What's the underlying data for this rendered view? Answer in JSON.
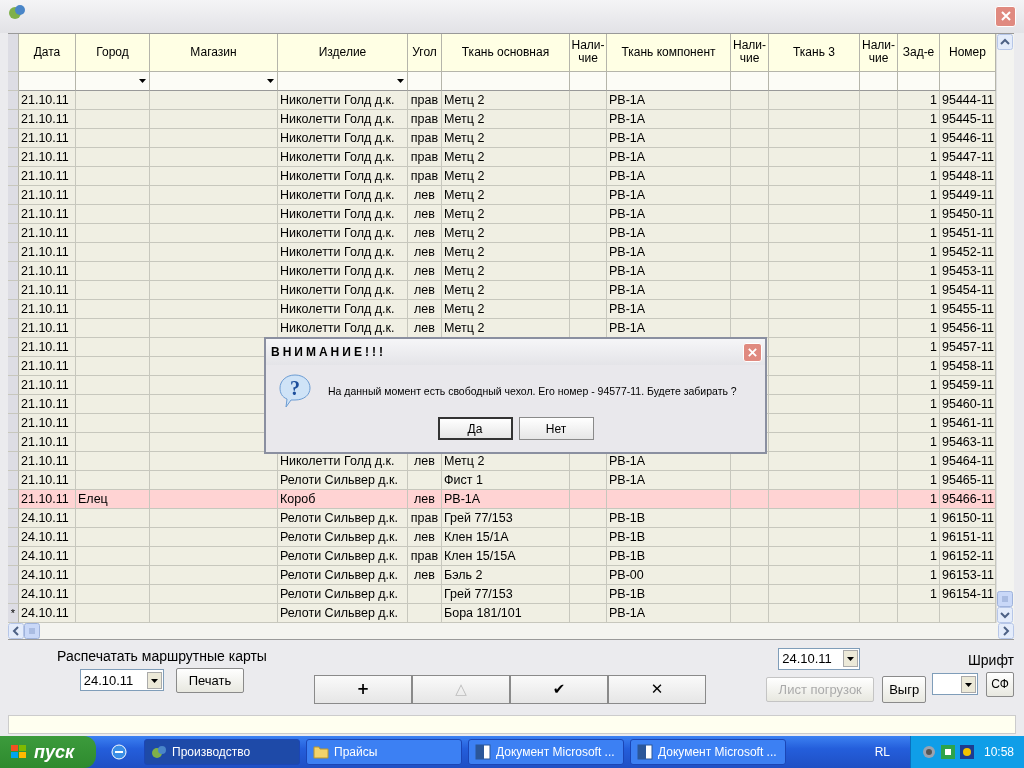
{
  "table": {
    "columns": [
      {
        "label": "Дата",
        "filter": false
      },
      {
        "label": "Город",
        "filter": true
      },
      {
        "label": "Магазин",
        "filter": true
      },
      {
        "label": "Изделие",
        "filter": true
      },
      {
        "label": "Угол",
        "filter": false
      },
      {
        "label": "Ткань основная",
        "filter": false
      },
      {
        "label": "Нали-\nчие",
        "filter": false
      },
      {
        "label": "Ткань компонент",
        "filter": false
      },
      {
        "label": "Нали-\nчие",
        "filter": false
      },
      {
        "label": "Ткань 3",
        "filter": false
      },
      {
        "label": "Нали-\nчие",
        "filter": false
      },
      {
        "label": "Зад-е",
        "filter": false
      },
      {
        "label": "Номер",
        "filter": false
      }
    ],
    "rows": [
      {
        "selected": false,
        "cells": [
          "21.10.11",
          null,
          null,
          "Николетти Голд д.к.",
          "прав",
          "Метц 2",
          null,
          "РВ-1А",
          null,
          null,
          null,
          "1",
          "95444-11"
        ]
      },
      {
        "selected": false,
        "cells": [
          "21.10.11",
          null,
          null,
          "Николетти Голд д.к.",
          "прав",
          "Метц 2",
          null,
          "РВ-1А",
          null,
          null,
          null,
          "1",
          "95445-11"
        ]
      },
      {
        "selected": false,
        "cells": [
          "21.10.11",
          null,
          null,
          "Николетти Голд д.к.",
          "прав",
          "Метц 2",
          null,
          "РВ-1А",
          null,
          null,
          null,
          "1",
          "95446-11"
        ]
      },
      {
        "selected": false,
        "cells": [
          "21.10.11",
          null,
          null,
          "Николетти Голд д.к.",
          "прав",
          "Метц 2",
          null,
          "РВ-1А",
          null,
          null,
          null,
          "1",
          "95447-11"
        ]
      },
      {
        "selected": false,
        "cells": [
          "21.10.11",
          null,
          null,
          "Николетти Голд д.к.",
          "прав",
          "Метц 2",
          null,
          "РВ-1А",
          null,
          null,
          null,
          "1",
          "95448-11"
        ]
      },
      {
        "selected": false,
        "cells": [
          "21.10.11",
          null,
          null,
          "Николетти Голд д.к.",
          "лев",
          "Метц 2",
          null,
          "РВ-1А",
          null,
          null,
          null,
          "1",
          "95449-11"
        ]
      },
      {
        "selected": false,
        "cells": [
          "21.10.11",
          null,
          null,
          "Николетти Голд д.к.",
          "лев",
          "Метц 2",
          null,
          "РВ-1А",
          null,
          null,
          null,
          "1",
          "95450-11"
        ]
      },
      {
        "selected": false,
        "cells": [
          "21.10.11",
          null,
          null,
          "Николетти Голд д.к.",
          "лев",
          "Метц 2",
          null,
          "РВ-1А",
          null,
          null,
          null,
          "1",
          "95451-11"
        ]
      },
      {
        "selected": false,
        "cells": [
          "21.10.11",
          null,
          null,
          "Николетти Голд д.к.",
          "лев",
          "Метц 2",
          null,
          "РВ-1А",
          null,
          null,
          null,
          "1",
          "95452-11"
        ]
      },
      {
        "selected": false,
        "cells": [
          "21.10.11",
          null,
          null,
          "Николетти Голд д.к.",
          "лев",
          "Метц 2",
          null,
          "РВ-1А",
          null,
          null,
          null,
          "1",
          "95453-11"
        ]
      },
      {
        "selected": false,
        "cells": [
          "21.10.11",
          null,
          null,
          "Николетти Голд д.к.",
          "лев",
          "Метц 2",
          null,
          "РВ-1А",
          null,
          null,
          null,
          "1",
          "95454-11"
        ]
      },
      {
        "selected": false,
        "cells": [
          "21.10.11",
          null,
          null,
          "Николетти Голд д.к.",
          "лев",
          "Метц 2",
          null,
          "РВ-1А",
          null,
          null,
          null,
          "1",
          "95455-11"
        ]
      },
      {
        "selected": false,
        "cells": [
          "21.10.11",
          null,
          null,
          "Николетти Голд д.к.",
          "лев",
          "Метц 2",
          null,
          "РВ-1А",
          null,
          null,
          null,
          "1",
          "95456-11"
        ]
      },
      {
        "selected": false,
        "cells": [
          "21.10.11",
          null,
          null,
          null,
          null,
          null,
          null,
          null,
          null,
          null,
          null,
          "1",
          "95457-11"
        ]
      },
      {
        "selected": false,
        "cells": [
          "21.10.11",
          null,
          null,
          null,
          null,
          null,
          null,
          null,
          null,
          null,
          null,
          "1",
          "95458-11"
        ]
      },
      {
        "selected": false,
        "cells": [
          "21.10.11",
          null,
          null,
          null,
          null,
          null,
          null,
          null,
          null,
          null,
          null,
          "1",
          "95459-11"
        ]
      },
      {
        "selected": false,
        "cells": [
          "21.10.11",
          null,
          null,
          null,
          null,
          null,
          null,
          null,
          null,
          null,
          null,
          "1",
          "95460-11"
        ]
      },
      {
        "selected": false,
        "cells": [
          "21.10.11",
          null,
          null,
          null,
          null,
          null,
          null,
          null,
          null,
          null,
          null,
          "1",
          "95461-11"
        ]
      },
      {
        "selected": false,
        "cells": [
          "21.10.11",
          null,
          null,
          null,
          null,
          null,
          null,
          null,
          null,
          null,
          null,
          "1",
          "95463-11"
        ]
      },
      {
        "selected": false,
        "cells": [
          "21.10.11",
          null,
          null,
          "Николетти Голд д.к.",
          "лев",
          "Метц 2",
          null,
          "РВ-1А",
          null,
          null,
          null,
          "1",
          "95464-11"
        ]
      },
      {
        "selected": false,
        "cells": [
          "21.10.11",
          null,
          null,
          "Релоти Сильвер д.к.",
          null,
          "Фист 1",
          null,
          "РВ-1А",
          null,
          null,
          null,
          "1",
          "95465-11"
        ]
      },
      {
        "selected": true,
        "cells": [
          "21.10.11",
          "Елец",
          null,
          "Короб",
          "лев",
          "РВ-1А",
          null,
          null,
          null,
          null,
          null,
          "1",
          "95466-11"
        ]
      },
      {
        "selected": false,
        "cells": [
          "24.10.11",
          null,
          null,
          "Релоти Сильвер д.к.",
          "прав",
          "Грей 77/153",
          null,
          "РВ-1В",
          null,
          null,
          null,
          "1",
          "96150-11"
        ]
      },
      {
        "selected": false,
        "cells": [
          "24.10.11",
          null,
          null,
          "Релоти Сильвер д.к.",
          "лев",
          "Клен 15/1А",
          null,
          "РВ-1В",
          null,
          null,
          null,
          "1",
          "96151-11"
        ]
      },
      {
        "selected": false,
        "cells": [
          "24.10.11",
          null,
          null,
          "Релоти Сильвер д.к.",
          "прав",
          "Клен 15/15А",
          null,
          "РВ-1В",
          null,
          null,
          null,
          "1",
          "96152-11"
        ]
      },
      {
        "selected": false,
        "cells": [
          "24.10.11",
          null,
          null,
          "Релоти Сильвер д.к.",
          "лев",
          "Бэль 2",
          null,
          "РВ-00",
          null,
          null,
          null,
          "1",
          "96153-11"
        ]
      },
      {
        "selected": false,
        "cells": [
          "24.10.11",
          null,
          null,
          "Релоти Сильвер д.к.",
          null,
          "Грей 77/153",
          null,
          "РВ-1В",
          null,
          null,
          null,
          "1",
          "96154-11"
        ]
      },
      {
        "selected": false,
        "marker": "*",
        "cells": [
          "24.10.11",
          null,
          null,
          "Релоти Сильвер д.к.",
          null,
          "Бора 181/101",
          null,
          "РВ-1А",
          null,
          null,
          null,
          null,
          null
        ]
      }
    ]
  },
  "bottom": {
    "print_label": "Распечатать маршрутные карты",
    "print_date": "24.10.11",
    "print_button": "Печать",
    "nav_buttons": [
      {
        "symbol": "+",
        "disabled": false
      },
      {
        "symbol": "△",
        "disabled": true
      },
      {
        "symbol": "✔",
        "disabled": false
      },
      {
        "symbol": "✕",
        "disabled": false
      }
    ],
    "date": "24.10.11",
    "load_sheet_button": {
      "label": "Лист погрузок",
      "disabled": true
    },
    "export_button": "Выгр",
    "font_label": "Шрифт",
    "sf_button": "СФ"
  },
  "dialog": {
    "title": "ВНИМАНИЕ!!!",
    "icon_symbol": "?",
    "message": "На данный момент есть свободный чехол. Его номер - 94577-11. Будете забирать ?",
    "buttons": [
      {
        "label": "Да",
        "selected": true
      },
      {
        "label": "Нет",
        "selected": false
      }
    ]
  },
  "taskbar": {
    "start": "пуск",
    "tasks": [
      {
        "label": "Производство",
        "kind": "app",
        "selected": true
      },
      {
        "label": "Прайсы",
        "kind": "folder",
        "selected": false
      },
      {
        "label": "Документ Microsoft ...",
        "kind": "word",
        "selected": false
      },
      {
        "label": "Документ Microsoft ...",
        "kind": "word",
        "selected": false
      }
    ],
    "language": "RL",
    "clock": "10:58"
  }
}
